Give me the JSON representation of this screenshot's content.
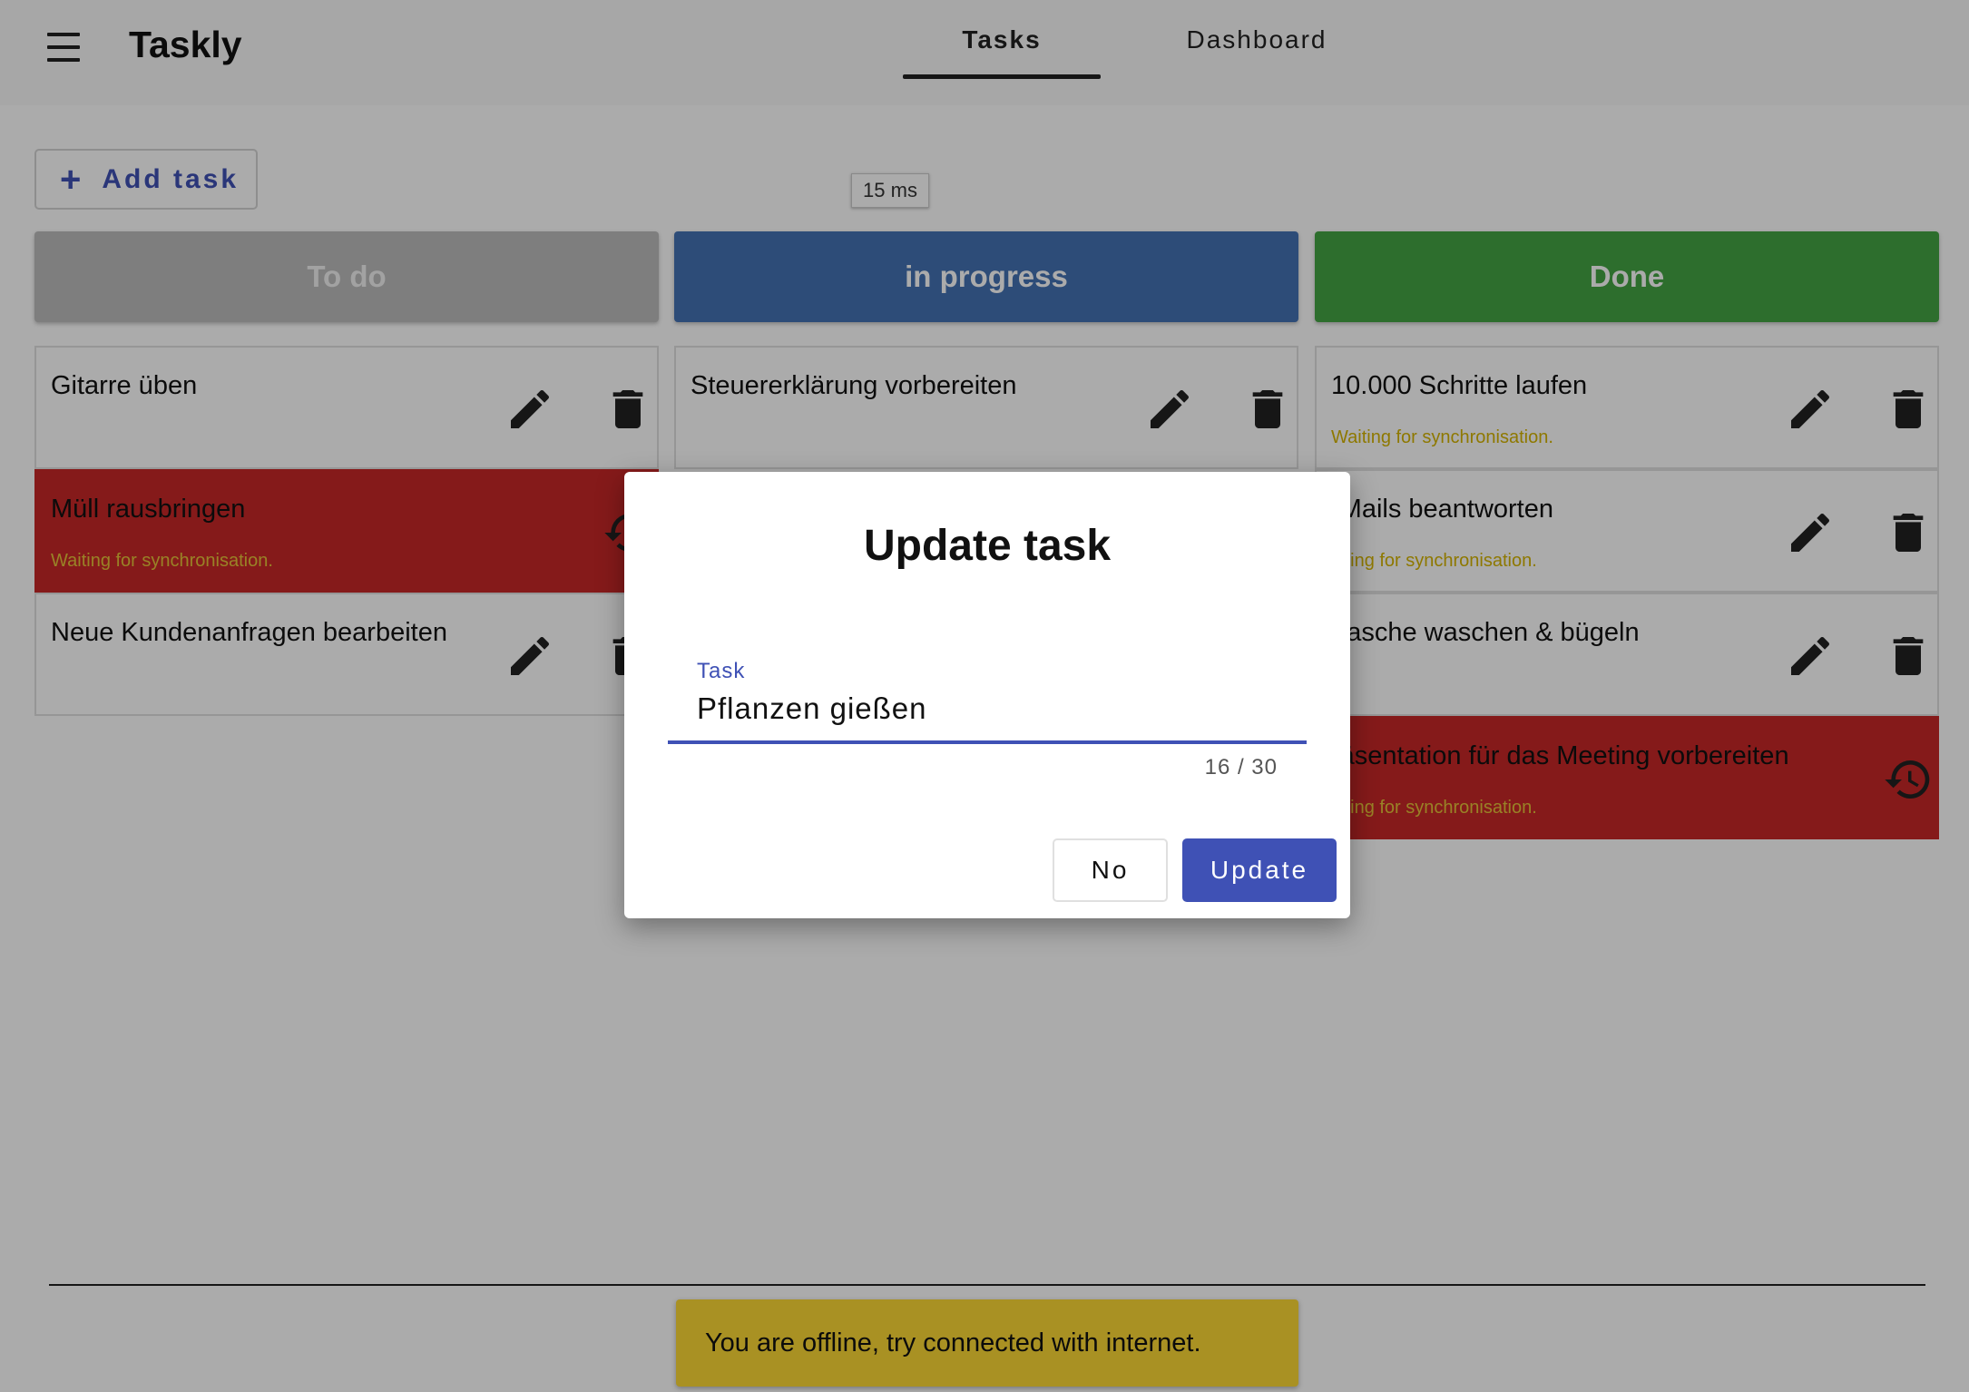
{
  "header": {
    "app_title": "Taskly",
    "menu_icon": "hamburger-menu-icon",
    "tabs": [
      {
        "label": "Tasks",
        "active": true
      },
      {
        "label": "Dashboard",
        "active": false
      }
    ]
  },
  "toolbar": {
    "add_task_label": "Add task",
    "add_task_icon": "plus-icon",
    "latency": "15 ms"
  },
  "columns": [
    {
      "title": "To do",
      "color": "#bdbdbd",
      "title_color": "#f2f2f2",
      "tasks": [
        {
          "title": "Gitarre üben",
          "sync": "",
          "error": false
        },
        {
          "title": "Müll rausbringen",
          "sync": "Waiting for synchronisation.",
          "error": true
        },
        {
          "title": "Neue Kundenanfragen bearbeiten",
          "sync": "",
          "error": false
        }
      ]
    },
    {
      "title": "in progress",
      "color": "#4472b4",
      "title_color": "#ffffff",
      "tasks": [
        {
          "title": "Steuererklärung vorbereiten",
          "sync": "",
          "error": false
        }
      ]
    },
    {
      "title": "Done",
      "color": "#44a543",
      "title_color": "#ffffff",
      "tasks": [
        {
          "title": "10.000 Schritte laufen",
          "sync": "Waiting for synchronisation.",
          "error": false
        },
        {
          "title": "-Mails beantworten",
          "sync": "aiting for synchronisation.",
          "error": false
        },
        {
          "title": "Vasche waschen & bügeln",
          "sync": "",
          "error": false
        },
        {
          "title": "räsentation für das Meeting vorbereiten",
          "sync": "aiting for synchronisation.",
          "error": true
        }
      ]
    }
  ],
  "icons": {
    "edit": "pencil-icon",
    "delete": "trash-icon",
    "retry": "restore-icon"
  },
  "dialog": {
    "title": "Update task",
    "field_label": "Task",
    "field_value": "Pflanzen gießen",
    "char_count": "16 / 30",
    "no_label": "No",
    "update_label": "Update"
  },
  "snackbar": {
    "message": "You are offline, try connected with internet."
  },
  "colors": {
    "accent": "#3f51b5",
    "error": "#c62828",
    "snackbar": "#fdd835",
    "sync_text": "#d4b400"
  }
}
